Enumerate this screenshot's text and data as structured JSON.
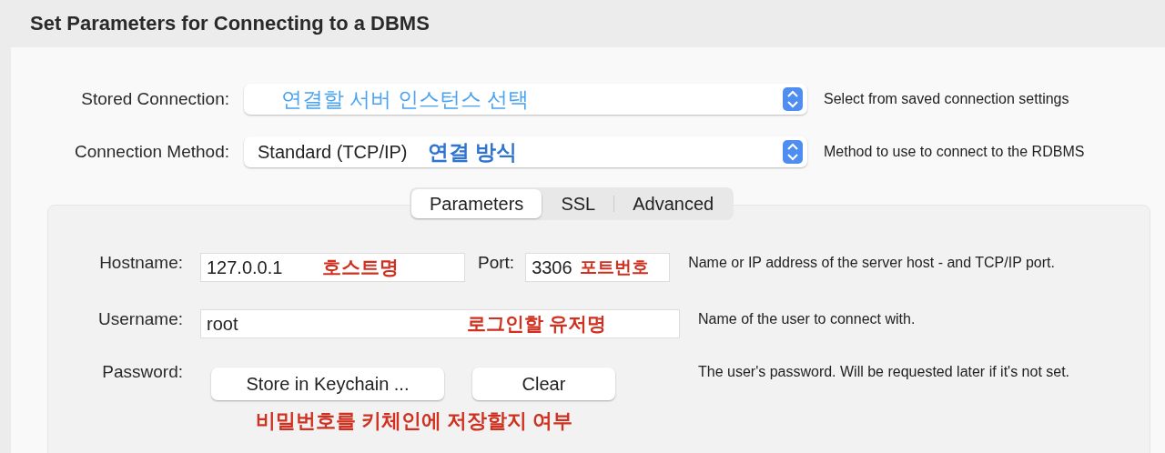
{
  "title": "Set Parameters for Connecting to a DBMS",
  "connection_rows": [
    {
      "label": "Stored Connection:",
      "value": "",
      "annotation": {
        "text": "연결할 서버 인스턴스 선택",
        "color": "#4aa3f0"
      },
      "description": "Select from saved connection settings"
    },
    {
      "label": "Connection Method:",
      "value": "Standard (TCP/IP)",
      "annotation": {
        "text": "연결 방식",
        "color": "#2f74d0"
      },
      "description": "Method to use to connect to the RDBMS"
    }
  ],
  "tabs": [
    {
      "label": "Parameters",
      "selected": true
    },
    {
      "label": "SSL",
      "selected": false
    },
    {
      "label": "Advanced",
      "selected": false
    }
  ],
  "hostname": {
    "label": "Hostname:",
    "value": "127.0.0.1",
    "annotation": {
      "text": "호스트명",
      "color": "#d0301f"
    }
  },
  "port": {
    "label": "Port:",
    "value": "3306",
    "annotation": {
      "text": "포트번호",
      "color": "#d0301f"
    }
  },
  "hostname_description": "Name or IP address of the server host - and TCP/IP port.",
  "username": {
    "label": "Username:",
    "value": "root",
    "annotation": {
      "text": "로그인할 유저명",
      "color": "#d0301f"
    },
    "description": "Name of the user to connect with."
  },
  "password": {
    "label": "Password:",
    "buttons": [
      "Store in Keychain ...",
      "Clear"
    ],
    "annotation": {
      "text": "비밀번호를 키체인에 저장할지 여부",
      "color": "#d0301f"
    },
    "description": "The user's password. Will be requested later if it's not set."
  }
}
